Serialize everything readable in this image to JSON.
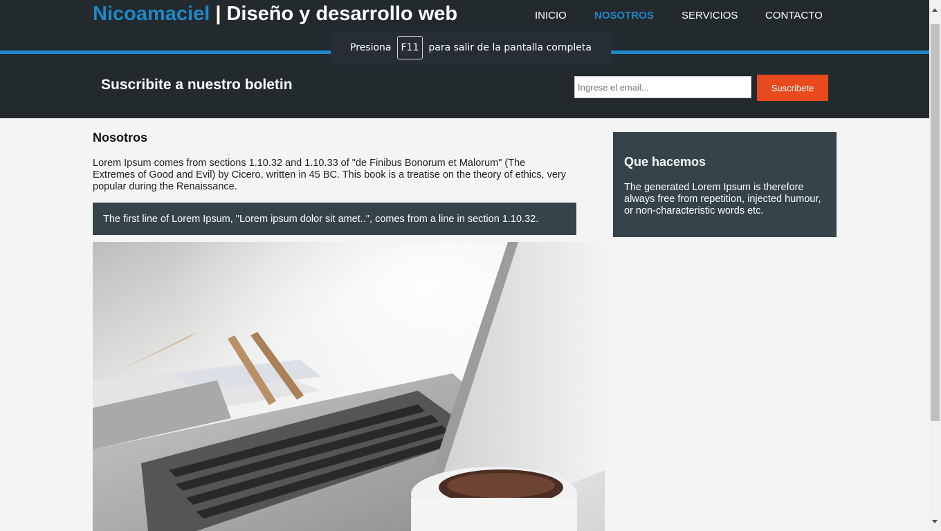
{
  "header": {
    "brand_highlight": "Nicoamaciel",
    "brand_rest": " | Diseño y desarrollo web",
    "nav": [
      {
        "label": "INICIO",
        "active": false
      },
      {
        "label": "NOSOTROS",
        "active": true
      },
      {
        "label": "SERVICIOS",
        "active": false
      },
      {
        "label": "CONTACTO",
        "active": false
      }
    ]
  },
  "fullscreen_notice": {
    "before": "Presiona",
    "key": "F11",
    "after": "para salir de la pantalla completa"
  },
  "newsletter": {
    "title": "Suscribite a nuestro boletin",
    "email_placeholder": "Ingrese el email...",
    "email_value": "",
    "button_label": "Suscribete"
  },
  "main": {
    "title": "Nosotros",
    "paragraph": "Lorem Ipsum comes from sections 1.10.32 and 1.10.33 of \"de Finibus Bonorum et Malorum\" (The Extremes of Good and Evil) by Cicero, written in 45 BC. This book is a treatise on the theory of ethics, very popular during the Renaissance.",
    "quote": "The first line of Lorem Ipsum, \"Lorem ipsum dolor sit amet..\", comes from a line in section 1.10.32."
  },
  "sidebar": {
    "title": "Que hacemos",
    "text": "The generated Lorem Ipsum is therefore always free from repetition, injected humour, or non-characteristic words etc."
  },
  "colors": {
    "header_bg": "#232a2e",
    "accent_blue": "#1f87c8",
    "button_orange": "#e8491d",
    "panel_bg": "#35434a",
    "page_bg": "#f4f4f4"
  }
}
